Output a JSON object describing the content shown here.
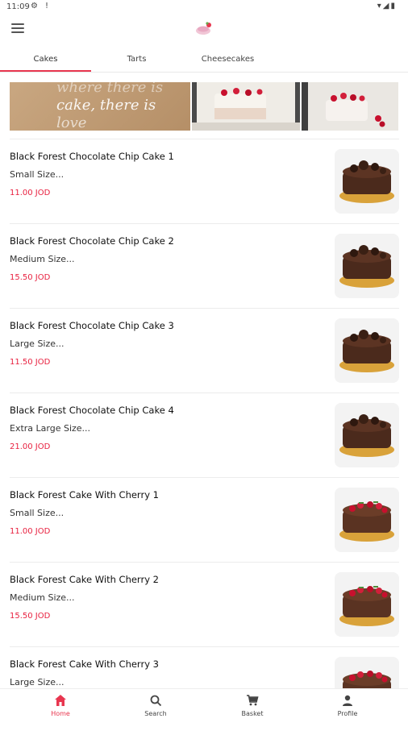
{
  "status_bar": {
    "time": "11:09"
  },
  "tabs": [
    {
      "label": "Cakes",
      "active": true
    },
    {
      "label": "Tarts",
      "active": false
    },
    {
      "label": "Cheesecakes",
      "active": false
    }
  ],
  "banner": {
    "text_line1": "where there is",
    "text_line2": "cake, there is",
    "text_line3": "love"
  },
  "products": [
    {
      "title": "Black Forest Chocolate Chip Cake 1",
      "size": "Small Size...",
      "price": "11.00 JOD",
      "thumb": "chocolate-cake"
    },
    {
      "title": "Black Forest Chocolate Chip Cake 2",
      "size": "Medium Size...",
      "price": "15.50 JOD",
      "thumb": "chocolate-cake"
    },
    {
      "title": "Black Forest Chocolate Chip Cake 3",
      "size": "Large Size...",
      "price": "11.50 JOD",
      "thumb": "chocolate-cake"
    },
    {
      "title": "Black Forest Chocolate Chip Cake 4",
      "size": "Extra Large Size...",
      "price": "21.00 JOD",
      "thumb": "chocolate-cake"
    },
    {
      "title": "Black Forest Cake With Cherry 1",
      "size": "Small Size...",
      "price": "11.00 JOD",
      "thumb": "cherry-cake"
    },
    {
      "title": "Black Forest Cake  With Cherry 2",
      "size": "Medium Size...",
      "price": "15.50 JOD",
      "thumb": "cherry-cake"
    },
    {
      "title": "Black Forest Cake  With Cherry 3",
      "size": "Large Size...",
      "price": "",
      "thumb": "cherry-cake"
    }
  ],
  "bottom_nav": [
    {
      "label": "Home",
      "icon": "home-icon",
      "active": true
    },
    {
      "label": "Search",
      "icon": "search-icon",
      "active": false
    },
    {
      "label": "Basket",
      "icon": "cart-icon",
      "active": false
    },
    {
      "label": "Profile",
      "icon": "profile-icon",
      "active": false
    }
  ],
  "colors": {
    "accent": "#e8364f",
    "price": "#e8203f"
  }
}
